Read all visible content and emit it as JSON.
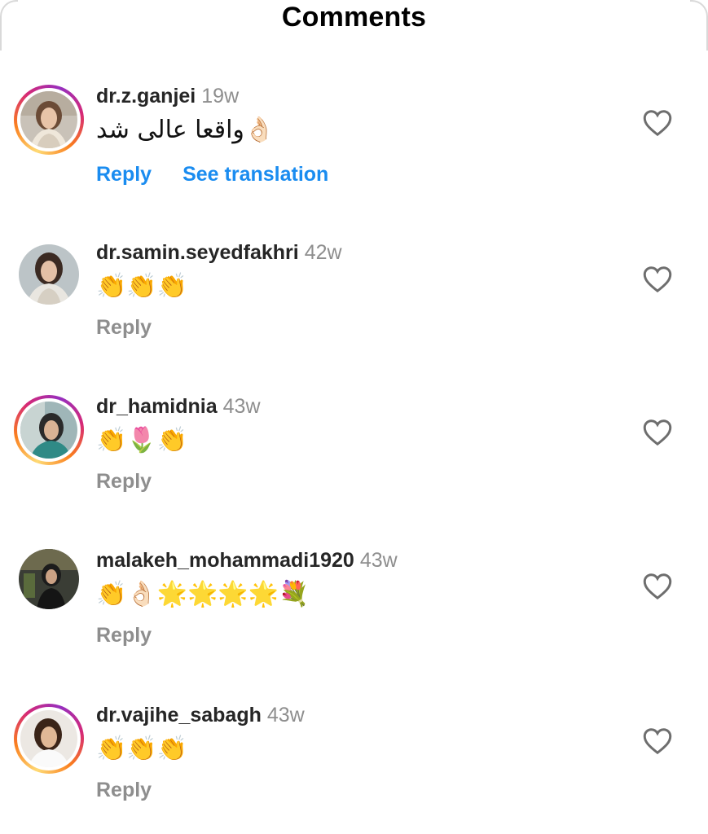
{
  "header": {
    "title": "Comments"
  },
  "comments": [
    {
      "username": "dr.z.ganjei",
      "age": "19w",
      "text": "واقعا عالی شد👌🏻",
      "reply_label": "Reply",
      "translation_label": "See translation",
      "has_story_ring": true
    },
    {
      "username": "dr.samin.seyedfakhri",
      "age": "42w",
      "text": "👏👏👏",
      "reply_label": "Reply",
      "has_story_ring": false
    },
    {
      "username": "dr_hamidnia",
      "age": "43w",
      "text": "👏🌷👏",
      "reply_label": "Reply",
      "has_story_ring": true
    },
    {
      "username": "malakeh_mohammadi1920",
      "age": "43w",
      "text": "👏👌🏻🌟🌟🌟🌟💐",
      "reply_label": "Reply",
      "has_story_ring": false
    },
    {
      "username": "dr.vajihe_sabagh",
      "age": "43w",
      "text": "👏👏👏",
      "reply_label": "Reply",
      "has_story_ring": true
    }
  ],
  "colors": {
    "link_blue": "#1a8cf0",
    "muted_gray": "#8e8e8e",
    "username": "#262626",
    "heart_outline": "#6e6e6e"
  },
  "icons": {
    "like": "heart-outline-icon"
  }
}
